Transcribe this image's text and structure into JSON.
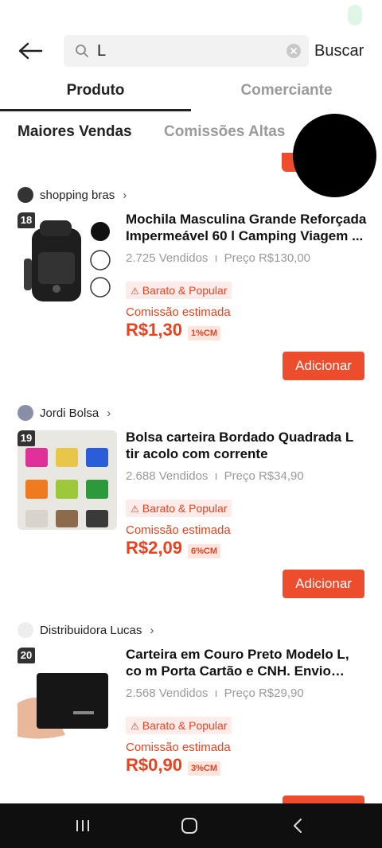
{
  "header": {
    "search_value": "L",
    "search_button": "Buscar"
  },
  "tabs": [
    {
      "label": "Produto",
      "active": true
    },
    {
      "label": "Comerciante",
      "active": false
    }
  ],
  "sorts": [
    {
      "label": "Maiores Vendas",
      "active": true
    },
    {
      "label": "Comissões Altas",
      "active": false
    }
  ],
  "colors": {
    "accent": "#ee4d2d",
    "text_muted": "#9a9a9a"
  },
  "products": [
    {
      "shop": "shopping bras",
      "rank": "18",
      "title": "Mochila Masculina Grande Reforçada Impermeável 60 l Camping Viagem ...",
      "sold": "2.725 Vendidos",
      "price": "Preço R$130,00",
      "tag": "Barato & Popular",
      "commission_label": "Comissão estimada",
      "commission_value": "R$1,30",
      "commission_pct": "1%CM",
      "add_label": "Adicionar"
    },
    {
      "shop": "Jordi Bolsa",
      "rank": "19",
      "title": "Bolsa carteira Bordado Quadrada L tir acolo com corrente",
      "sold": "2.688 Vendidos",
      "price": "Preço R$34,90",
      "tag": "Barato & Popular",
      "commission_label": "Comissão estimada",
      "commission_value": "R$2,09",
      "commission_pct": "6%CM",
      "add_label": "Adicionar"
    },
    {
      "shop": "Distribuidora Lucas",
      "rank": "20",
      "title": "Carteira em Couro Preto Modelo L, co m Porta Cartão e CNH. Envio Imedi...",
      "sold": "2.568 Vendidos",
      "price": "Preço R$29,90",
      "tag": "Barato & Popular",
      "commission_label": "Comissão estimada",
      "commission_value": "R$0,90",
      "commission_pct": "3%CM",
      "add_label": "Adicionar"
    }
  ]
}
